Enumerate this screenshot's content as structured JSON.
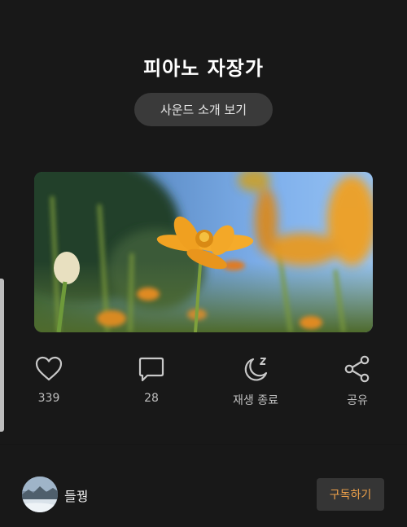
{
  "track": {
    "title": "피아노 자장가"
  },
  "intro_button": {
    "label": "사운드 소개 보기"
  },
  "hero_image": {
    "description": "orange-cosmos-flower-photo"
  },
  "actions": {
    "like": {
      "count": "339",
      "icon": "heart-icon"
    },
    "comment": {
      "count": "28",
      "icon": "comment-icon"
    },
    "sleep_timer": {
      "label": "재생 종료",
      "icon": "moon-sleep-icon"
    },
    "share": {
      "label": "공유",
      "icon": "share-icon"
    }
  },
  "channel": {
    "name": "들꿩",
    "subscribe_label": "구독하기"
  },
  "colors": {
    "background": "#181818",
    "accent": "#f0a24a",
    "button_bg": "#3a3a3a"
  }
}
